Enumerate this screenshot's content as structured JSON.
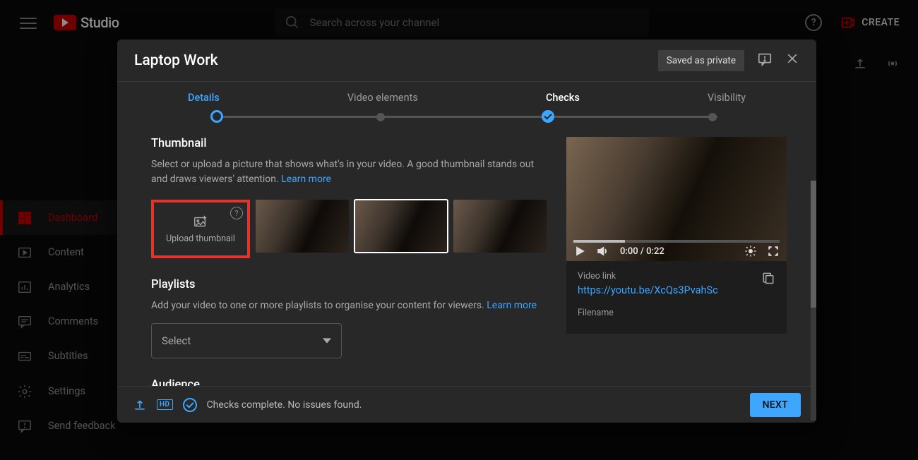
{
  "topbar": {
    "logo_text": "Studio",
    "search_placeholder": "Search across your channel",
    "create_label": "CREATE"
  },
  "sidebar": {
    "items": [
      {
        "label": "Dashboard"
      },
      {
        "label": "Content"
      },
      {
        "label": "Analytics"
      },
      {
        "label": "Comments"
      },
      {
        "label": "Subtitles"
      }
    ],
    "bottom": [
      {
        "label": "Settings"
      },
      {
        "label": "Send feedback"
      }
    ]
  },
  "modal": {
    "title": "Laptop Work",
    "saved_pill": "Saved as private",
    "steps": {
      "details": "Details",
      "elements": "Video elements",
      "checks": "Checks",
      "visibility": "Visibility"
    },
    "thumbnail": {
      "heading": "Thumbnail",
      "description": "Select or upload a picture that shows what's in your video. A good thumbnail stands out and draws viewers' attention. ",
      "learn_more": "Learn more",
      "upload_label": "Upload thumbnail"
    },
    "playlists": {
      "heading": "Playlists",
      "description": "Add your video to one or more playlists to organise your content for viewers. ",
      "learn_more": "Learn more",
      "select_placeholder": "Select"
    },
    "audience_heading": "Audience",
    "player": {
      "time": "0:00 / 0:22",
      "link_label": "Video link",
      "link_value": "https://youtu.be/XcQs3PvahSc",
      "filename_label": "Filename"
    },
    "footer": {
      "hd": "HD",
      "status": "Checks complete. No issues found.",
      "next": "NEXT"
    }
  }
}
